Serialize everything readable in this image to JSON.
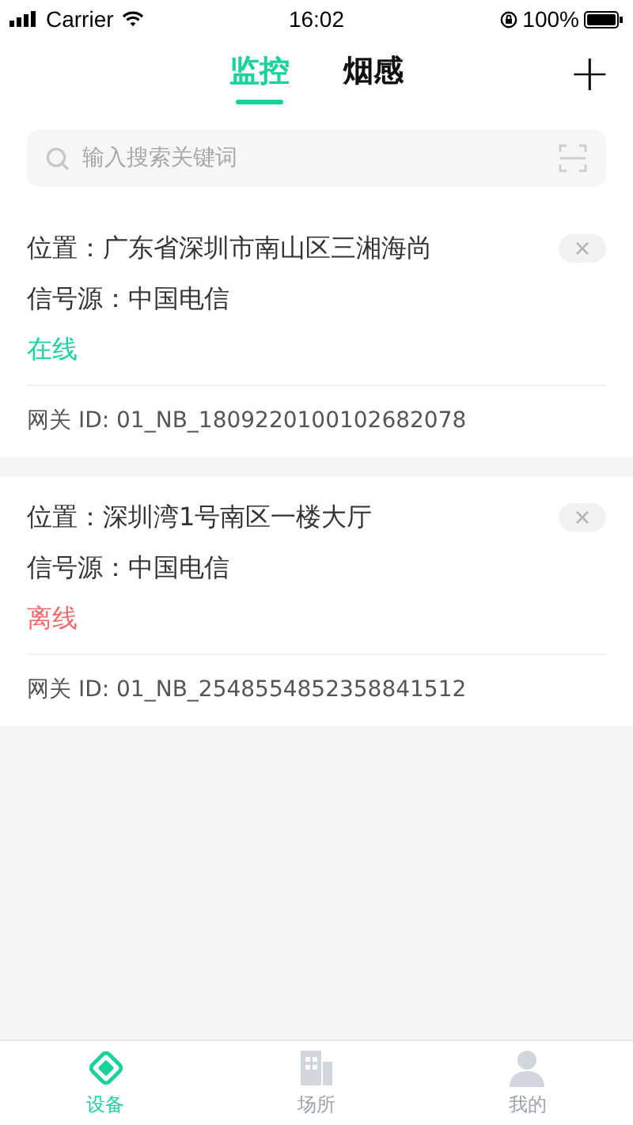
{
  "status_bar": {
    "carrier": "Carrier",
    "time": "16:02",
    "battery": "100%"
  },
  "tabs": [
    {
      "label": "监控",
      "selected": true
    },
    {
      "label": "烟感",
      "selected": false
    }
  ],
  "add_button": "+",
  "search": {
    "placeholder": "输入搜索关键词"
  },
  "devices": [
    {
      "location": "位置：广东省深圳市南山区三湘海尚",
      "signal": "信号源：中国电信",
      "status": "在线",
      "online": true,
      "gateway": "网关 ID: 01_NB_1809220100102682078"
    },
    {
      "location": "位置：深圳湾1号南区一楼大厅",
      "signal": "信号源：中国电信",
      "status": "离线",
      "online": false,
      "gateway": "网关 ID: 01_NB_2548554852358841512"
    }
  ],
  "bottom_tabs": [
    {
      "label": "设备",
      "kind": "device",
      "selected": true
    },
    {
      "label": "场所",
      "kind": "place",
      "selected": false
    },
    {
      "label": "我的",
      "kind": "profile",
      "selected": false
    }
  ]
}
